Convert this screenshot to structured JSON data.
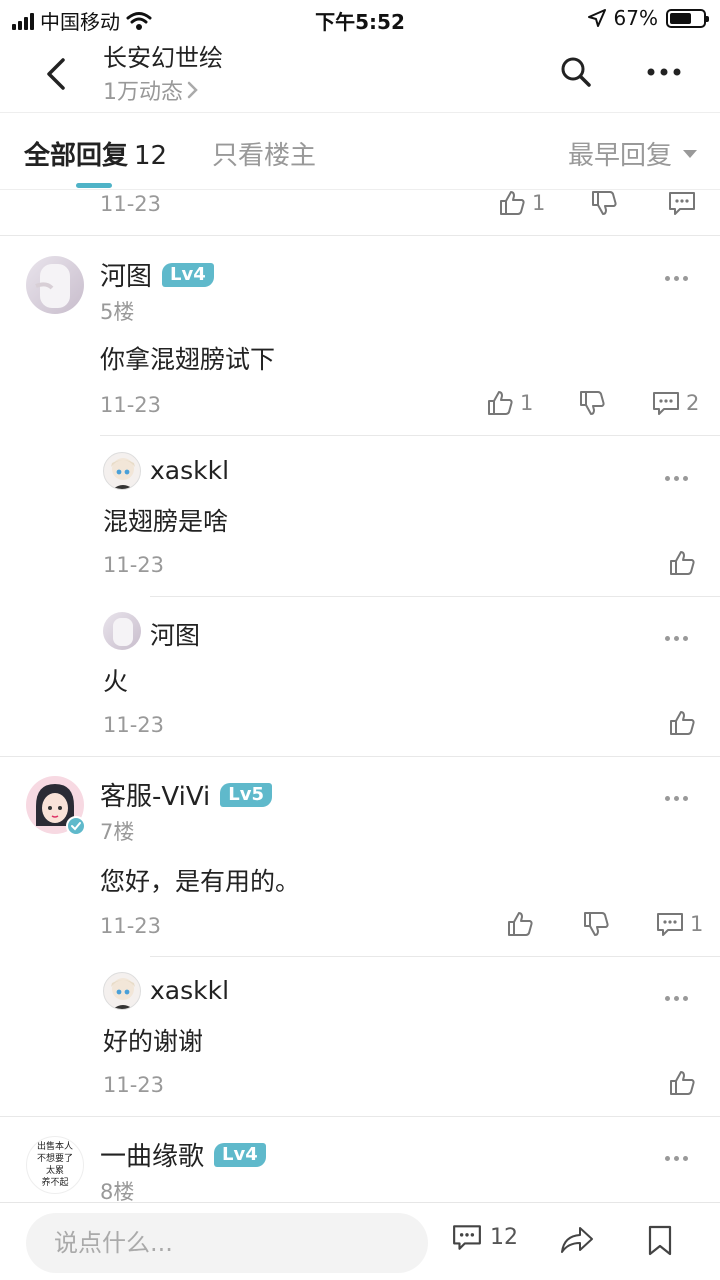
{
  "status_bar": {
    "carrier": "中国移动",
    "time": "下午5:52",
    "battery": "67%",
    "battery_level": 0.67
  },
  "header": {
    "title": "长安幻世绘",
    "subtitle": "1万动态"
  },
  "tabs": {
    "all_label": "全部回复",
    "all_count": "12",
    "op_only": "只看楼主",
    "sort_label": "最早回复"
  },
  "partial_top": {
    "date": "11-23",
    "like_count": "1"
  },
  "floor5": {
    "username": "河图",
    "level": "Lv4",
    "floor": "5楼",
    "text": "你拿混翅膀试下",
    "date": "11-23",
    "like_count": "1",
    "comment_count": "2",
    "replies": [
      {
        "username": "xaskkl",
        "text": "混翅膀是啥",
        "date": "11-23"
      },
      {
        "username": "河图",
        "text": "火",
        "date": "11-23"
      }
    ]
  },
  "floor7": {
    "username": "客服-ViVi",
    "level": "Lv5",
    "floor": "7楼",
    "text": "您好，是有用的。",
    "date": "11-23",
    "comment_count": "1",
    "replies": [
      {
        "username": "xaskkl",
        "text": "好的谢谢",
        "date": "11-23"
      }
    ]
  },
  "floor8": {
    "username": "一曲缘歌",
    "level": "Lv4",
    "floor": "8楼",
    "avatar_text": [
      "出售本人",
      "不想要了",
      "太累",
      "养不起"
    ]
  },
  "bottom_bar": {
    "placeholder": "说点什么...",
    "comment_count": "12"
  },
  "colors": {
    "accent": "#4fb3c7",
    "level_badge": "#5fb9cb",
    "muted": "#999999"
  }
}
